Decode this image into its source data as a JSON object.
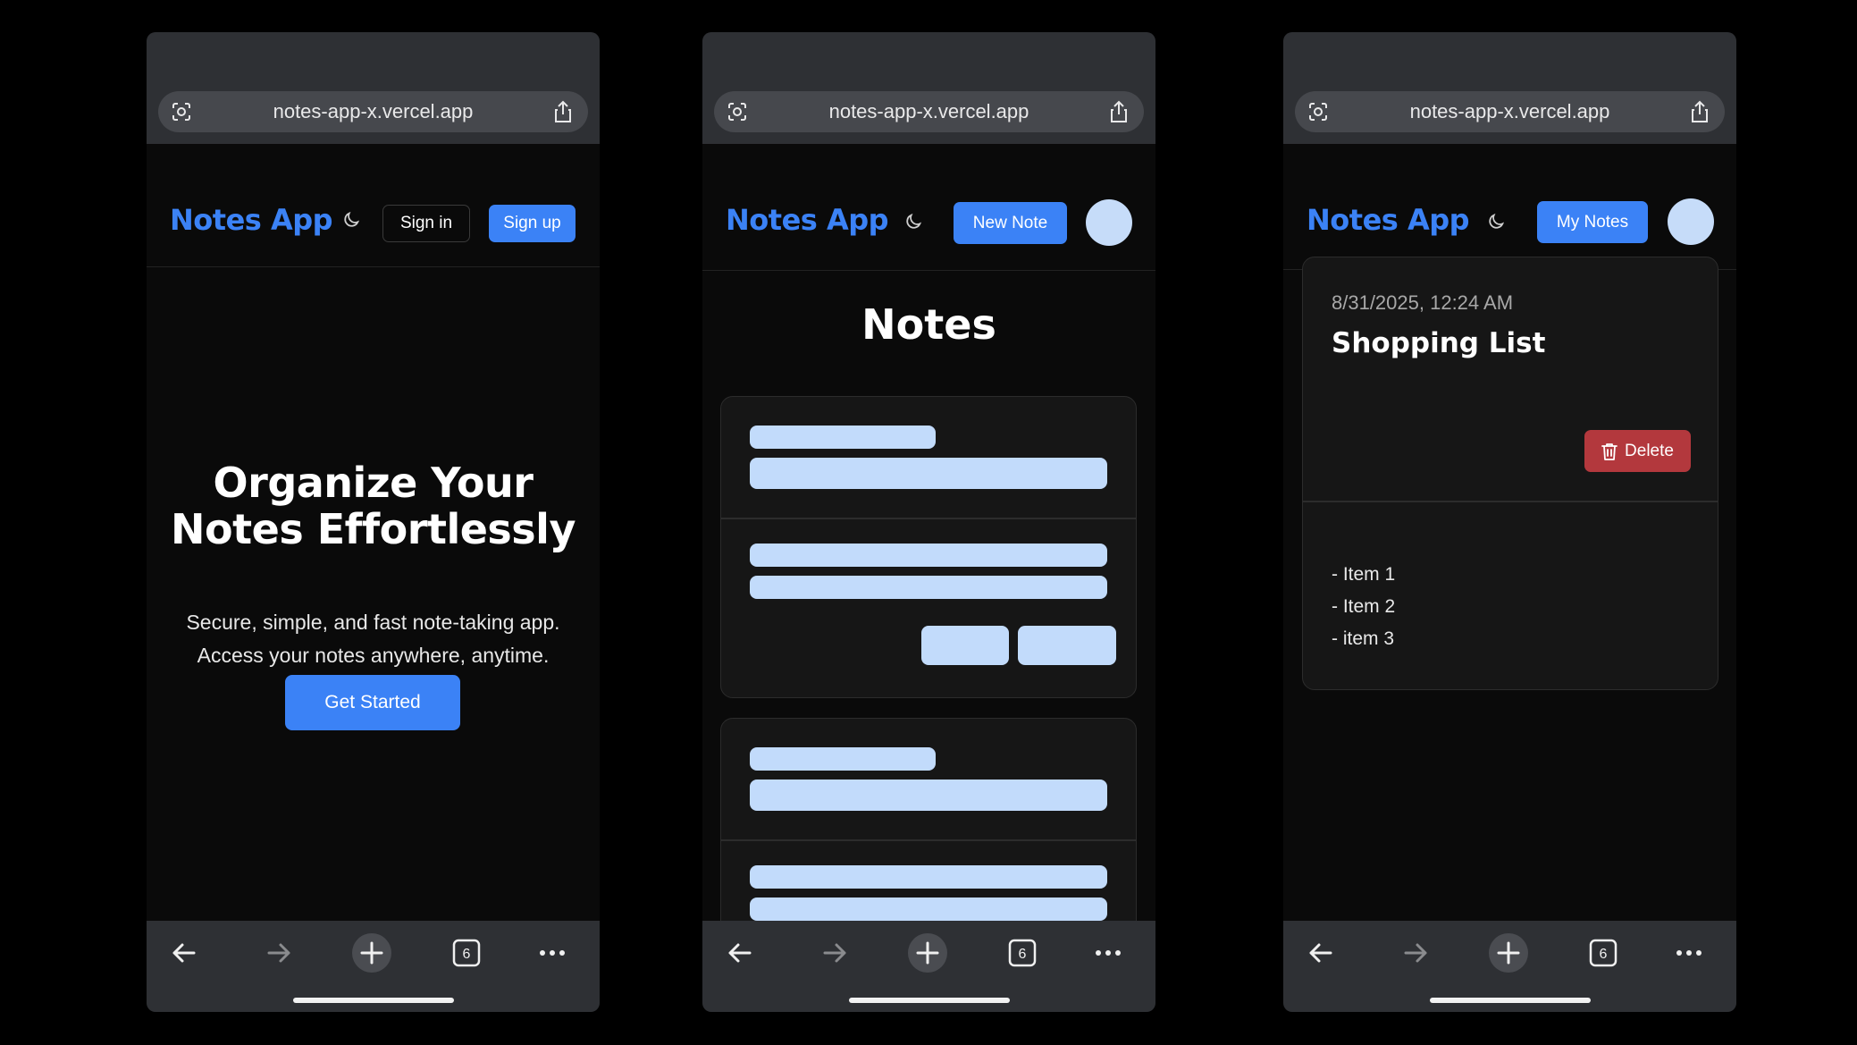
{
  "browser": {
    "url": "notes-app-x.vercel.app",
    "tab_count": "6",
    "icons": {
      "left": "lens-icon",
      "right": "share-icon",
      "back": "arrow-left-icon",
      "forward": "arrow-right-icon",
      "new_tab": "plus-icon",
      "tabs": "tabs-icon",
      "menu": "more-icon"
    }
  },
  "app": {
    "logo": "Notes App",
    "theme_icon": "moon-icon",
    "accent": "#3b82f6"
  },
  "screen1": {
    "sign_in": "Sign in",
    "sign_up": "Sign up",
    "hero_line1": "Organize Your",
    "hero_line2": "Notes Effortlessly",
    "sub_line1": "Secure, simple, and fast note-taking app.",
    "sub_line2": "Access your notes anywhere, anytime.",
    "cta": "Get Started"
  },
  "screen2": {
    "new_note": "New Note",
    "heading": "Notes"
  },
  "screen3": {
    "my_notes": "My Notes",
    "note": {
      "date": "8/31/2025, 12:24 AM",
      "title": "Shopping List",
      "delete_label": "Delete",
      "delete_color": "#b3383d",
      "lines": [
        "- Item 1",
        "- Item 2",
        "- item 3"
      ]
    }
  }
}
